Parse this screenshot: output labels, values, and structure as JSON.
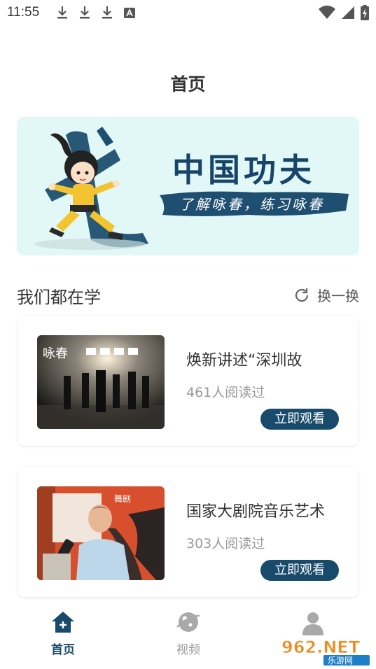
{
  "status_bar": {
    "time": "11:55",
    "left_icons": [
      "download-icon",
      "download-icon",
      "download-icon",
      "accessibility-a-icon"
    ],
    "right_icons": [
      "wifi-icon",
      "signal-icon",
      "battery-charging-icon"
    ]
  },
  "page": {
    "title": "首页"
  },
  "banner": {
    "title": "中国功夫",
    "subtitle": "了解咏春，练习咏春",
    "colors": {
      "background": "#e2f8f6",
      "title": "#17456a",
      "brush": "#1f4f70"
    }
  },
  "section": {
    "title": "我们都在学",
    "refresh_label": "换一换",
    "refresh_icon": "refresh-icon"
  },
  "cards": [
    {
      "title": "焕新讲述“深圳故",
      "reads": "461人阅读过",
      "button": "立即观看",
      "thumb_text": "咏春"
    },
    {
      "title": "国家大剧院音乐艺术",
      "reads": "303人阅读过",
      "button": "立即观看",
      "thumb_text": "舞剧"
    }
  ],
  "bottom_nav": {
    "items": [
      {
        "label": "首页",
        "icon": "home-icon",
        "active": true
      },
      {
        "label": "视频",
        "icon": "video-planet-icon",
        "active": false
      },
      {
        "label": "",
        "icon": "user-icon",
        "active": false
      }
    ],
    "active_color": "#184a6b",
    "inactive_color": "#999999"
  },
  "watermark": {
    "text": "962.NET",
    "subtext": "乐游网"
  }
}
